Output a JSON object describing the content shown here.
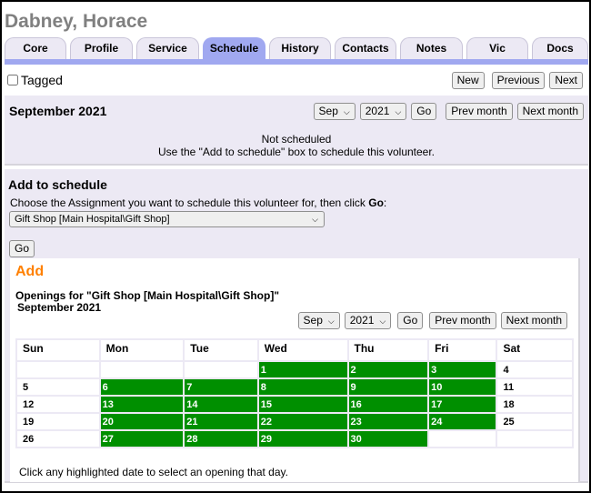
{
  "header": {
    "title": "Dabney, Horace"
  },
  "tabs": [
    {
      "label": "Core",
      "active": false
    },
    {
      "label": "Profile",
      "active": false
    },
    {
      "label": "Service",
      "active": false
    },
    {
      "label": "Schedule",
      "active": true
    },
    {
      "label": "History",
      "active": false
    },
    {
      "label": "Contacts",
      "active": false
    },
    {
      "label": "Notes",
      "active": false
    },
    {
      "label": "Vic",
      "active": false
    },
    {
      "label": "Docs",
      "active": false
    }
  ],
  "toolbar": {
    "tagged_label": "Tagged",
    "tagged_checked": false,
    "new_label": "New",
    "previous_label": "Previous",
    "next_label": "Next"
  },
  "schedule": {
    "month_title": "September 2021",
    "month_select": "Sep",
    "year_select": "2021",
    "go_label": "Go",
    "prev_month_label": "Prev month",
    "next_month_label": "Next month",
    "status_line1": "Not scheduled",
    "status_line2": "Use the \"Add to schedule\" box to schedule this volunteer."
  },
  "add_to_schedule": {
    "title": "Add to schedule",
    "instruction_prefix": "Choose the Assignment you want to schedule this volunteer for, then click ",
    "instruction_bold": "Go",
    "instruction_suffix": ":",
    "assignment_selected": "Gift Shop [Main Hospital\\Gift Shop]",
    "go_label": "Go"
  },
  "add_section": {
    "heading": "Add",
    "openings_title": "Openings for \"Gift Shop [Main Hospital\\Gift Shop]\"",
    "openings_month": "September 2021",
    "month_select": "Sep",
    "year_select": "2021",
    "go_label": "Go",
    "prev_month_label": "Prev month",
    "next_month_label": "Next month",
    "calendar": {
      "weekdays": [
        "Sun",
        "Mon",
        "Tue",
        "Wed",
        "Thu",
        "Fri",
        "Sat"
      ],
      "weeks": [
        [
          null,
          null,
          null,
          {
            "day": "1",
            "open": true
          },
          {
            "day": "2",
            "open": true
          },
          {
            "day": "3",
            "open": true
          },
          {
            "day": "4",
            "open": false
          }
        ],
        [
          {
            "day": "5",
            "open": false
          },
          {
            "day": "6",
            "open": true
          },
          {
            "day": "7",
            "open": true
          },
          {
            "day": "8",
            "open": true
          },
          {
            "day": "9",
            "open": true
          },
          {
            "day": "10",
            "open": true
          },
          {
            "day": "11",
            "open": false
          }
        ],
        [
          {
            "day": "12",
            "open": false
          },
          {
            "day": "13",
            "open": true
          },
          {
            "day": "14",
            "open": true
          },
          {
            "day": "15",
            "open": true
          },
          {
            "day": "16",
            "open": true
          },
          {
            "day": "17",
            "open": true
          },
          {
            "day": "18",
            "open": false
          }
        ],
        [
          {
            "day": "19",
            "open": false
          },
          {
            "day": "20",
            "open": true
          },
          {
            "day": "21",
            "open": true
          },
          {
            "day": "22",
            "open": true
          },
          {
            "day": "23",
            "open": true
          },
          {
            "day": "24",
            "open": true
          },
          {
            "day": "25",
            "open": false
          }
        ],
        [
          {
            "day": "26",
            "open": false
          },
          {
            "day": "27",
            "open": true
          },
          {
            "day": "28",
            "open": true
          },
          {
            "day": "29",
            "open": true
          },
          {
            "day": "30",
            "open": true
          },
          null,
          null
        ]
      ]
    },
    "footer_note": "Click any highlighted date to select an opening that day."
  },
  "colors": {
    "tab_active": "#a0a8f0",
    "panel_bg": "#ece9f4",
    "open_day": "#008f00",
    "add_heading": "#ff8000",
    "title_gray": "#808080"
  },
  "icons": {
    "dropdown": "chevron-down-icon",
    "checkbox": "checkbox-icon"
  }
}
